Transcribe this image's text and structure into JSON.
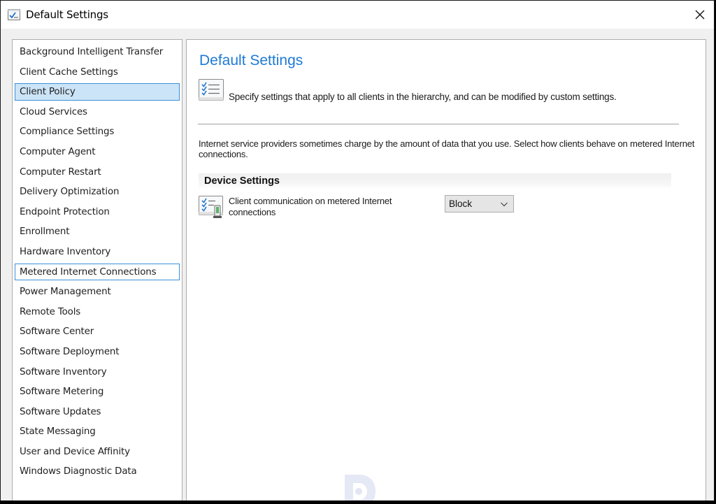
{
  "window": {
    "title": "Default Settings",
    "icon": "settings-checklist-icon",
    "close_icon": "close-icon"
  },
  "sidebar": {
    "selected_index": 2,
    "focused_index": 11,
    "items": [
      {
        "label": "Background Intelligent Transfer"
      },
      {
        "label": "Client Cache Settings"
      },
      {
        "label": "Client Policy"
      },
      {
        "label": "Cloud Services"
      },
      {
        "label": "Compliance Settings"
      },
      {
        "label": "Computer Agent"
      },
      {
        "label": "Computer Restart"
      },
      {
        "label": "Delivery Optimization"
      },
      {
        "label": "Endpoint Protection"
      },
      {
        "label": "Enrollment"
      },
      {
        "label": "Hardware Inventory"
      },
      {
        "label": "Metered Internet Connections"
      },
      {
        "label": "Power Management"
      },
      {
        "label": "Remote Tools"
      },
      {
        "label": "Software Center"
      },
      {
        "label": "Software Deployment"
      },
      {
        "label": "Software Inventory"
      },
      {
        "label": "Software Metering"
      },
      {
        "label": "Software Updates"
      },
      {
        "label": "State Messaging"
      },
      {
        "label": "User and Device Affinity"
      },
      {
        "label": "Windows Diagnostic Data"
      }
    ]
  },
  "main": {
    "title": "Default Settings",
    "description": "Specify settings that apply to all clients in the hierarchy, and can be modified by custom settings.",
    "intro": "Internet service providers sometimes charge by the amount of data that you use. Select how clients behave on metered Internet connections.",
    "section": {
      "title": "Device Settings",
      "settings": [
        {
          "label": "Client communication on metered Internet connections",
          "value": "Block",
          "icon": "metered-connection-setting-icon"
        }
      ]
    }
  },
  "colors": {
    "accent_title": "#1e7ad6",
    "selection_bg": "#cce4f7",
    "selection_border": "#3c8fd8"
  }
}
